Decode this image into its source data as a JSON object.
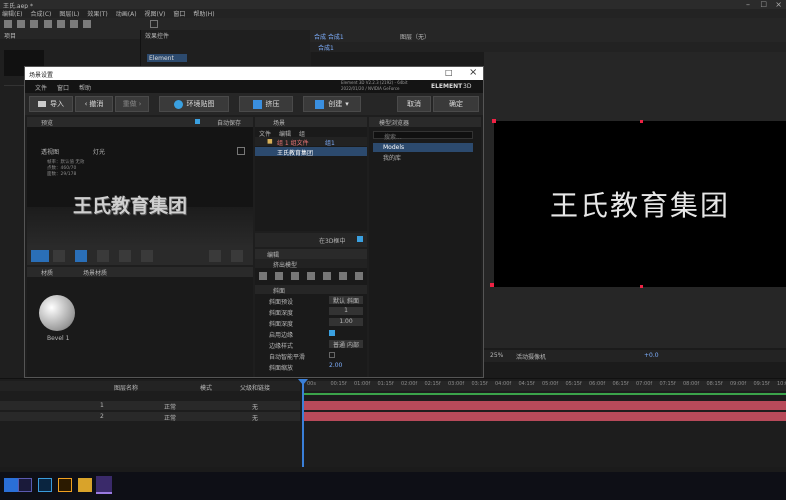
{
  "ae": {
    "title": "王氏.aep *",
    "menu": [
      "编辑(E)",
      "合成(C)",
      "图层(L)",
      "效果(T)",
      "动画(A)",
      "视图(V)",
      "窗口",
      "帮助(H)"
    ],
    "project_label": "项目",
    "effects_label": "效果控件",
    "comp_tab": "合成 合成1",
    "layer_label": "图层（无）",
    "comp_subtab": "合成1",
    "viewer_text": "王氏教育集团",
    "zoom": "25%",
    "camera_select": "活动摄像机",
    "viewer_value": "+0.0",
    "layer_rows": [
      {
        "num": "1",
        "name": "Element"
      },
      {
        "num": "2",
        "name": "王氏教育集团"
      }
    ],
    "timeline_cols": [
      "图层名称",
      "父级和链接",
      "模式"
    ],
    "ticks": [
      "00s",
      "00:15f",
      "01:00f",
      "01:15f",
      "02:00f",
      "02:15f",
      "03:00f",
      "03:15f",
      "04:00f",
      "04:15f",
      "05:00f",
      "05:15f",
      "06:00f",
      "06:15f",
      "07:00f",
      "07:15f",
      "08:00f",
      "08:15f",
      "09:00f",
      "09:15f",
      "10:00f"
    ],
    "mode_values": [
      "正常",
      "正常"
    ],
    "parent_values": [
      "无",
      "无"
    ]
  },
  "dialog": {
    "title": "场景设置",
    "menu": [
      "文件",
      "窗口",
      "帮助"
    ],
    "version_line1": "Element 3D V2.2.3 (2192) - 64bit",
    "version_line2": "2022/01/20 / NVIDIA GeForce",
    "brand": "ELEMENT",
    "brand_version": "3D",
    "toolbar": {
      "import": "导入",
      "undo": "撤消",
      "redo": "重做",
      "env": "环境贴图",
      "extrude": "挤压",
      "create": "创建",
      "cancel": "取消",
      "ok": "确定"
    },
    "preview": {
      "tab": "预览",
      "option": "自动保存",
      "dropdown1": "透视图",
      "dropdown2": "灯光",
      "info": [
        "帧率：默认值 无效",
        "点数：460/70",
        "面数：29/178"
      ],
      "text3d": "王氏教育集团"
    },
    "scene": {
      "tab": "场景",
      "cols": [
        "文件",
        "编辑",
        "组"
      ],
      "group": "组 1 组文件",
      "item": "王氏教育集团",
      "badge": "组1",
      "tag": "在3D框中"
    },
    "browser": {
      "tab": "模型浏览器",
      "search_placeholder": "搜索...",
      "folders": [
        "Models",
        "我的库"
      ]
    },
    "material": {
      "tab1": "材质",
      "tab2": "场景材质",
      "sphere_label": "Bevel 1"
    },
    "edit": {
      "tab": "编辑",
      "subtab": "挤出模型",
      "section": "斜面",
      "props": [
        {
          "label": "斜面预设",
          "value": "默认 斜面"
        },
        {
          "label": "斜面深度",
          "value": "1"
        },
        {
          "label": "斜面深度",
          "value": "1.00"
        },
        {
          "label": "启用边缘",
          "value": ""
        },
        {
          "label": "边缘样式",
          "value": "普通 内部"
        },
        {
          "label": "自动智能平滑",
          "value": ""
        },
        {
          "label": "斜面缩放",
          "value": "2.00"
        }
      ]
    }
  },
  "taskbar": [
    "ae-icon",
    "ps-icon",
    "ai-icon",
    "folder-icon",
    "e3d-icon"
  ]
}
